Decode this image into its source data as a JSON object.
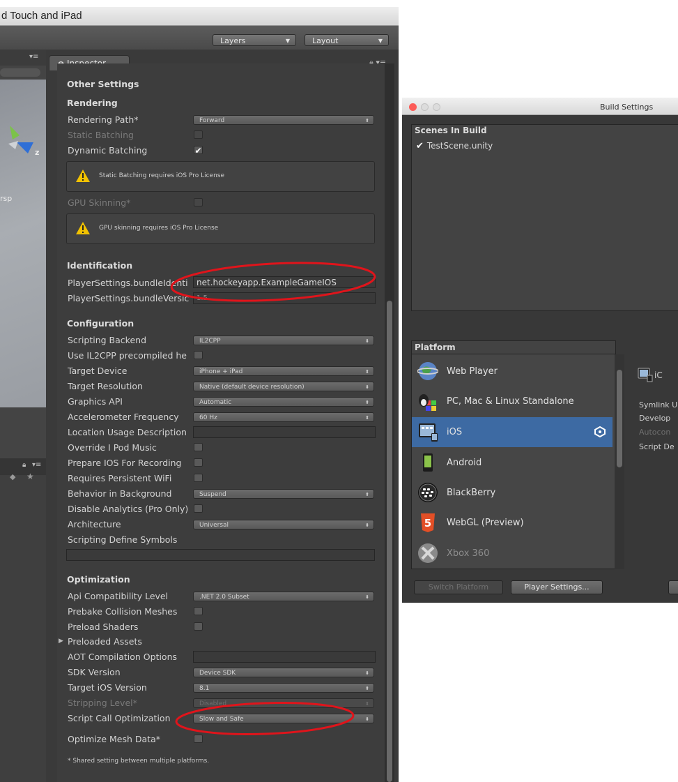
{
  "window": {
    "title": "d Touch and iPad",
    "layers_label": "Layers",
    "layout_label": "Layout"
  },
  "scene": {
    "persp_label": "rsp",
    "axis_label": "z"
  },
  "inspector": {
    "tab_label": "Inspector",
    "other_settings": "Other Settings",
    "rendering": {
      "header": "Rendering",
      "rendering_path_label": "Rendering Path*",
      "rendering_path_value": "Forward",
      "static_batching_label": "Static Batching",
      "dynamic_batching_label": "Dynamic Batching",
      "static_warning": "Static Batching requires iOS Pro License",
      "gpu_skinning_label": "GPU Skinning*",
      "gpu_warning": "GPU skinning requires iOS Pro License"
    },
    "identification": {
      "header": "Identification",
      "bundle_id_label": "PlayerSettings.bundleIdenti",
      "bundle_id_value": "net.hockeyapp.ExampleGameIOS",
      "bundle_version_label": "PlayerSettings.bundleVersic",
      "bundle_version_value": "1.5"
    },
    "configuration": {
      "header": "Configuration",
      "scripting_backend_label": "Scripting Backend",
      "scripting_backend_value": "IL2CPP",
      "il2cpp_precompiled_label": "Use IL2CPP precompiled he",
      "target_device_label": "Target Device",
      "target_device_value": "iPhone + iPad",
      "target_resolution_label": "Target Resolution",
      "target_resolution_value": "Native (default device resolution)",
      "graphics_api_label": "Graphics API",
      "graphics_api_value": "Automatic",
      "accelerometer_label": "Accelerometer Frequency",
      "accelerometer_value": "60 Hz",
      "location_label": "Location Usage Description",
      "override_music_label": "Override I Pod Music",
      "prepare_recording_label": "Prepare IOS For Recording",
      "persistent_wifi_label": "Requires Persistent WiFi",
      "behavior_background_label": "Behavior in Background",
      "behavior_background_value": "Suspend",
      "disable_analytics_label": "Disable Analytics (Pro Only)",
      "architecture_label": "Architecture",
      "architecture_value": "Universal",
      "define_symbols_label": "Scripting Define Symbols"
    },
    "optimization": {
      "header": "Optimization",
      "api_compat_label": "Api Compatibility Level",
      "api_compat_value": ".NET 2.0 Subset",
      "prebake_label": "Prebake Collision Meshes",
      "preload_shaders_label": "Preload Shaders",
      "preloaded_assets_label": "Preloaded Assets",
      "aot_label": "AOT Compilation Options",
      "sdk_version_label": "SDK Version",
      "sdk_version_value": "Device SDK",
      "target_ios_label": "Target iOS Version",
      "target_ios_value": "8.1",
      "stripping_label": "Stripping Level*",
      "stripping_value": "Disabled",
      "script_call_label": "Script Call Optimization",
      "script_call_value": "Slow and Safe",
      "optimize_mesh_label": "Optimize Mesh Data*"
    },
    "footnote": "* Shared setting between multiple platforms."
  },
  "build": {
    "title": "Build Settings",
    "scenes_header": "Scenes In Build",
    "scene_name": "TestScene.unity",
    "platform_header": "Platform",
    "platforms": [
      {
        "name": "Web Player"
      },
      {
        "name": "PC, Mac & Linux Standalone"
      },
      {
        "name": "iOS"
      },
      {
        "name": "Android"
      },
      {
        "name": "BlackBerry"
      },
      {
        "name": "WebGL (Preview)"
      },
      {
        "name": "Xbox 360"
      }
    ],
    "selected_platform_short": "iC",
    "right_labels": [
      "Symlink U",
      "Develop",
      "Autocon",
      "Script De"
    ],
    "switch_platform_label": "Switch Platform",
    "player_settings_label": "Player Settings..."
  },
  "colors": {
    "selection": "#3d6aa3",
    "annotation": "#e0141b",
    "warning": "#f2c200"
  }
}
